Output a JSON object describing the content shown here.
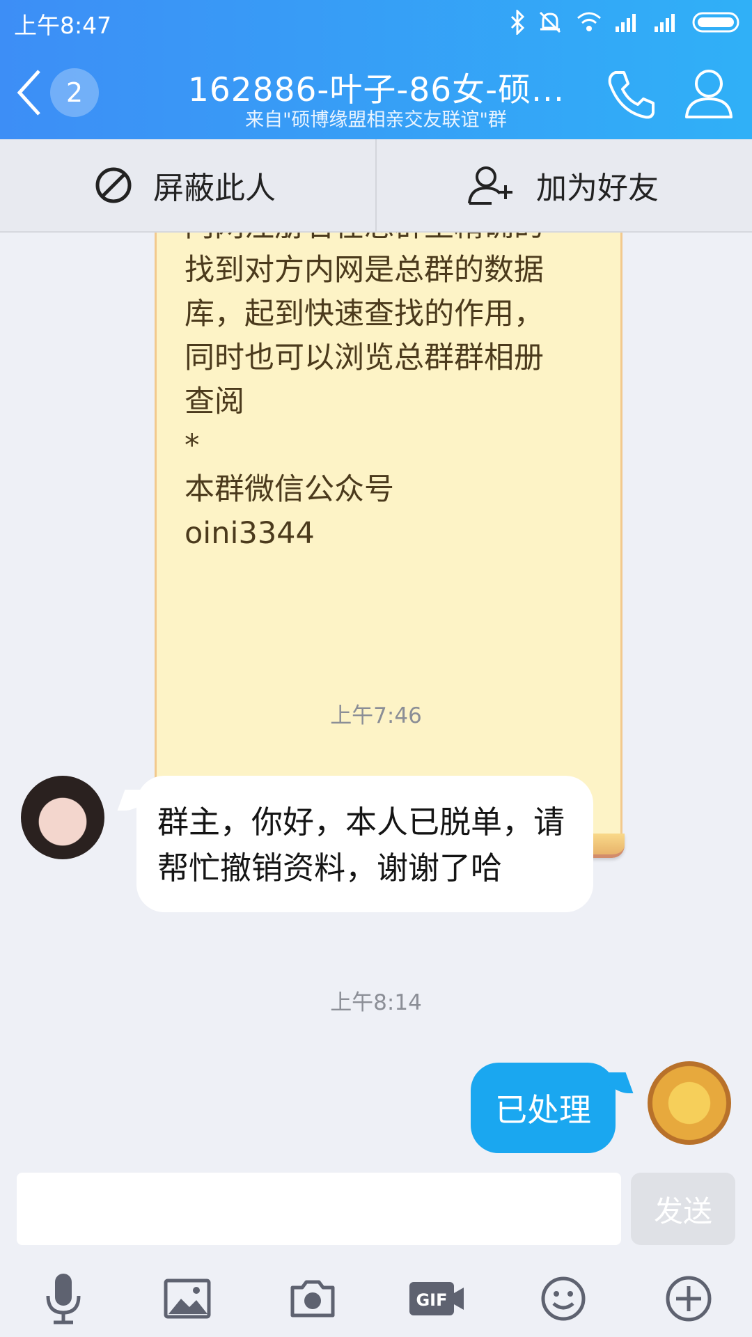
{
  "status_bar": {
    "time": "上午8:47"
  },
  "header": {
    "unread_count": "2",
    "title": "162886-叶子-86女-硕...",
    "subtitle": "来自\"硕博缘盟相亲交友联谊\"群"
  },
  "actions": {
    "block_label": "屏蔽此人",
    "add_friend_label": "加为好友"
  },
  "notice": {
    "text": "内网注册名在总群里精确的\n找到对方内网是总群的数据\n库，起到快速查找的作用，\n同时也可以浏览总群群相册\n查阅\n*\n本群微信公众号\noini3344"
  },
  "messages": {
    "time_1": "上午7:46",
    "incoming_text": "群主，你好，本人已脱单，请帮忙撤销资料，谢谢了哈",
    "time_2": "上午8:14",
    "outgoing_text": "已处理"
  },
  "composer": {
    "placeholder": "",
    "send_label": "发送"
  },
  "toolbar": {
    "icons": [
      "microphone-icon",
      "image-icon",
      "camera-icon",
      "gif-icon",
      "emoji-icon",
      "plus-icon"
    ]
  }
}
